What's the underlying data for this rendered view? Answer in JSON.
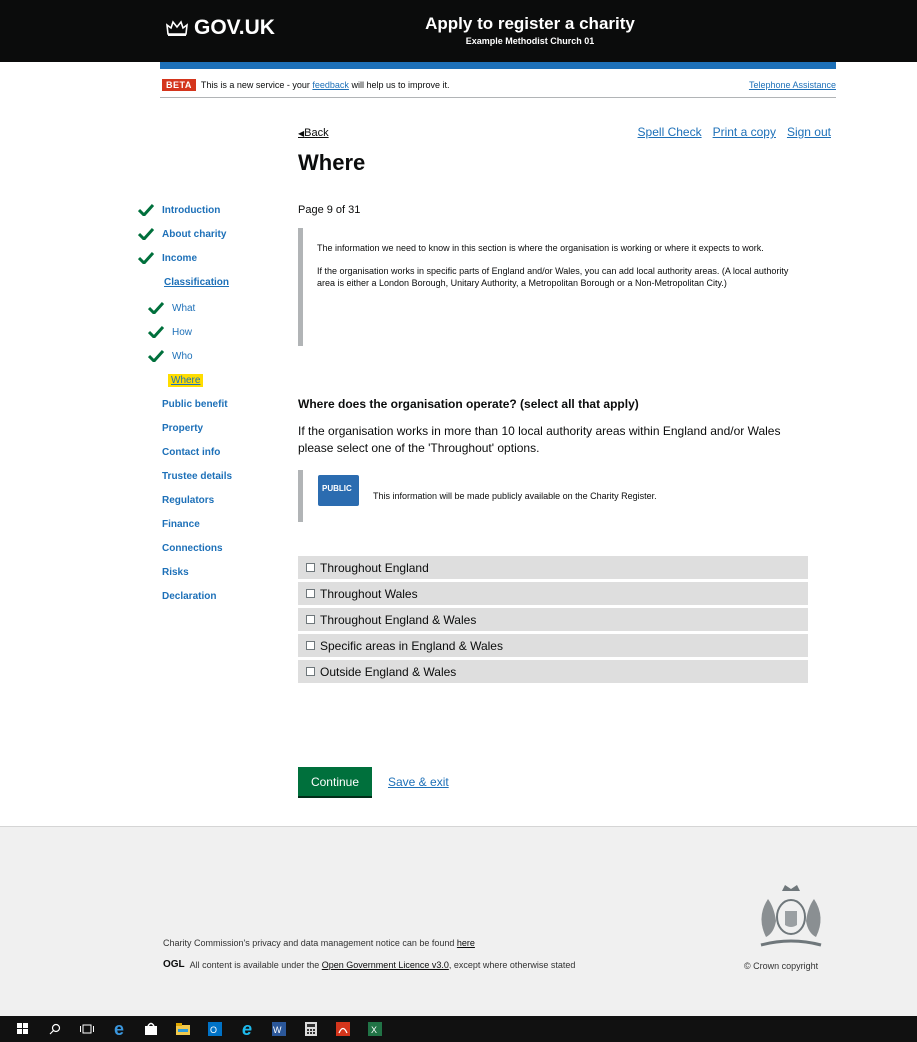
{
  "header": {
    "logo_text": "GOV.UK",
    "service_name": "Apply to register a charity",
    "service_sub": "Example Methodist Church 01",
    "accent": "#1d70b8"
  },
  "beta": {
    "tag": "BETA",
    "text_before": "This is a new service - your",
    "feedback_link": "feedback",
    "text_after": "will help us to improve it.",
    "telephone": "Telephone Assistance"
  },
  "toolbar": {
    "back": "Back",
    "spell_check": "Spell Check",
    "print": "Print a copy",
    "sign_out": "Sign out"
  },
  "page": {
    "title": "Where",
    "count": "Page 9 of 31"
  },
  "sidenav": {
    "items": [
      {
        "label": "Introduction",
        "done": true
      },
      {
        "label": "About charity",
        "done": true
      },
      {
        "label": "Income",
        "done": true
      },
      {
        "label": "Classification",
        "done": false
      },
      {
        "label": "What",
        "done": true
      },
      {
        "label": "How",
        "done": true
      },
      {
        "label": "Who",
        "done": true
      },
      {
        "label": "Where",
        "done": false,
        "current": true
      },
      {
        "label": "Public benefit",
        "done": false
      },
      {
        "label": "Property",
        "done": false
      },
      {
        "label": "Contact info",
        "done": false
      },
      {
        "label": "Trustee details",
        "done": false
      },
      {
        "label": "Regulators",
        "done": false
      },
      {
        "label": "Finance",
        "done": false
      },
      {
        "label": "Connections",
        "done": false
      },
      {
        "label": "Risks",
        "done": false
      },
      {
        "label": "Declaration",
        "done": false
      }
    ]
  },
  "inset": {
    "para1": "The information we need to know in this section is where the organisation is working or where it expects to work.",
    "para2": "If the organisation works in specific parts of England and/or Wales, you can add local authority areas. (A local authority area is either a London Borough, Unitary Authority, a Metropolitan Borough or a Non-Metropolitan City.)"
  },
  "question": {
    "legend": "Where does the organisation operate? (select all that apply)",
    "hint": "If the organisation works in more than 10 local authority areas within England and/or Wales please select one of the 'Throughout' options.",
    "public_badge": "PUBLIC",
    "public_text": "This information will be made publicly available on the Charity Register.",
    "options": [
      "Throughout England",
      "Throughout Wales",
      "Throughout England & Wales",
      "Specific areas in England & Wales",
      "Outside England & Wales"
    ]
  },
  "actions": {
    "continue": "Continue",
    "save_exit": "Save & exit"
  },
  "footer": {
    "privacy_text": "Charity Commission's privacy and data management notice can be found",
    "privacy_link": "here",
    "ogl_logo": "OGL",
    "ogl_before": "All content is available under the",
    "ogl_link": "Open Government Licence v3.0",
    "ogl_after": ", except where otherwise stated",
    "copyright": "© Crown copyright"
  },
  "taskbar": {
    "icons": [
      "windows-icon",
      "search-icon",
      "task-view-icon",
      "edge-icon",
      "store-icon",
      "file-explorer-icon",
      "outlook-icon",
      "internet-explorer-icon",
      "word-icon",
      "calculator-icon",
      "acrobat-icon",
      "excel-icon"
    ]
  }
}
